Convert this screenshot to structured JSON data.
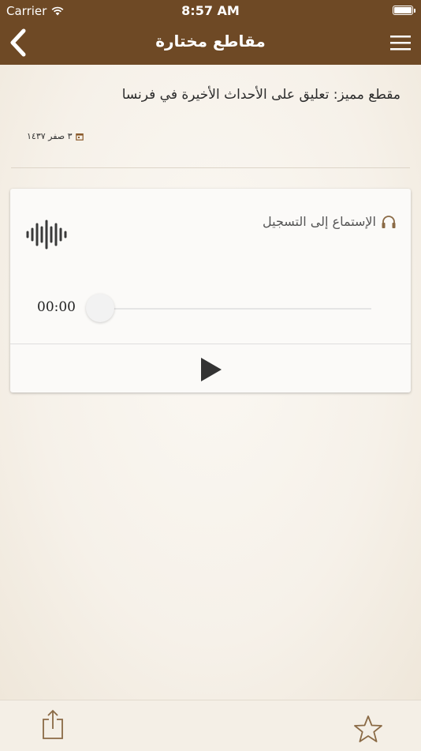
{
  "status_bar": {
    "carrier": "Carrier",
    "time": "8:57 AM"
  },
  "nav": {
    "title": "مقاطع مختارة",
    "back_icon": "chevron-left-icon",
    "menu_icon": "hamburger-menu-icon"
  },
  "post": {
    "title": "مقطع مميز: تعليق على الأحداث الأخيرة في فرنسا",
    "date": "٣ صفر ١٤٣٧",
    "date_icon": "calendar-icon"
  },
  "audio_card": {
    "heading": "الإستماع إلى التسجيل",
    "heading_icon": "headphones-icon",
    "waveform_icon": "sound-wave-icon",
    "current_time": "00:00",
    "progress": 0,
    "play_icon": "play-icon"
  },
  "tabbar": {
    "share_icon": "share-icon",
    "favorite_icon": "star-icon"
  },
  "colors": {
    "header_bg": "#6e4925",
    "background": "#f6f1e9",
    "accent_icon": "#8a6a45"
  }
}
